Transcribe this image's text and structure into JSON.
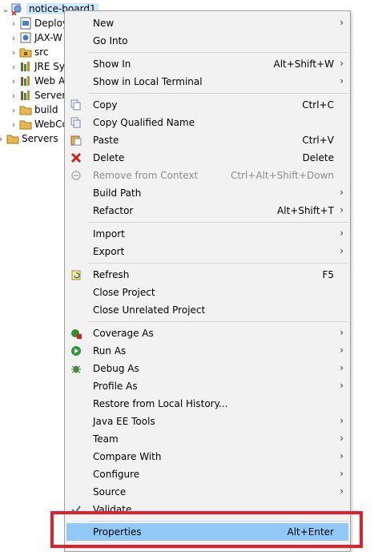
{
  "tree": {
    "root": "notice-board1",
    "children": [
      {
        "label": "Deploy",
        "icon": "deployment-descriptor-icon"
      },
      {
        "label": "JAX-W",
        "icon": "jax-ws-icon"
      },
      {
        "label": "src",
        "icon": "source-folder-icon"
      },
      {
        "label": "JRE Sy",
        "icon": "library-icon"
      },
      {
        "label": "Web A",
        "icon": "library-icon"
      },
      {
        "label": "Server",
        "icon": "library-icon"
      },
      {
        "label": "build",
        "icon": "folder-icon"
      },
      {
        "label": "WebCo",
        "icon": "folder-icon"
      }
    ],
    "servers": "Servers"
  },
  "menu": {
    "new": {
      "label": "New"
    },
    "go_into": {
      "label": "Go Into"
    },
    "show_in": {
      "label": "Show In",
      "shortcut": "Alt+Shift+W"
    },
    "show_terminal": {
      "label": "Show in Local Terminal"
    },
    "copy": {
      "label": "Copy",
      "shortcut": "Ctrl+C"
    },
    "copy_qualified": {
      "label": "Copy Qualified Name"
    },
    "paste": {
      "label": "Paste",
      "shortcut": "Ctrl+V"
    },
    "delete": {
      "label": "Delete",
      "shortcut": "Delete"
    },
    "remove_context": {
      "label": "Remove from Context",
      "shortcut": "Ctrl+Alt+Shift+Down"
    },
    "build_path": {
      "label": "Build Path"
    },
    "refactor": {
      "label": "Refactor",
      "shortcut": "Alt+Shift+T"
    },
    "import": {
      "label": "Import"
    },
    "export": {
      "label": "Export"
    },
    "refresh": {
      "label": "Refresh",
      "shortcut": "F5"
    },
    "close_project": {
      "label": "Close Project"
    },
    "close_unrelated": {
      "label": "Close Unrelated Project"
    },
    "coverage_as": {
      "label": "Coverage As"
    },
    "run_as": {
      "label": "Run As"
    },
    "debug_as": {
      "label": "Debug As"
    },
    "profile_as": {
      "label": "Profile As"
    },
    "restore_history": {
      "label": "Restore from Local History..."
    },
    "java_ee_tools": {
      "label": "Java EE Tools"
    },
    "team": {
      "label": "Team"
    },
    "compare_with": {
      "label": "Compare With"
    },
    "configure": {
      "label": "Configure"
    },
    "source": {
      "label": "Source"
    },
    "validate": {
      "label": "Validate"
    },
    "properties": {
      "label": "Properties",
      "shortcut": "Alt+Enter"
    }
  },
  "colors": {
    "highlight": "#90c8f6",
    "callout": "#e0202a",
    "selection": "#cce8ff"
  }
}
